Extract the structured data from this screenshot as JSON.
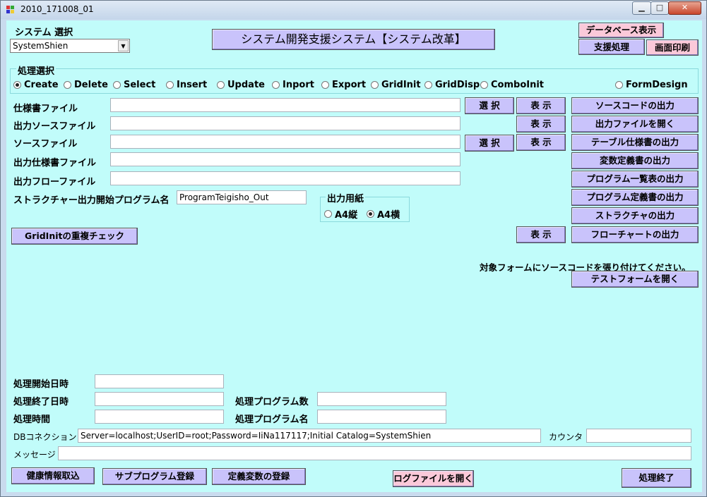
{
  "window": {
    "title": "2010_171008_01"
  },
  "header": {
    "system_label": "システム 選択",
    "system_value": "SystemShien",
    "main_title": "システム開発支援システム【システム改革】",
    "db_view_button": "データベース表示",
    "support_button": "支援処理",
    "print_button": "画面印刷"
  },
  "process": {
    "group_label": "処理選択",
    "options": [
      {
        "label": "Create",
        "checked": true
      },
      {
        "label": "Delete",
        "checked": false
      },
      {
        "label": "Select",
        "checked": false
      },
      {
        "label": "Insert",
        "checked": false
      },
      {
        "label": "Update",
        "checked": false
      },
      {
        "label": "Inport",
        "checked": false
      },
      {
        "label": "Export",
        "checked": false
      },
      {
        "label": "GridInit",
        "checked": false
      },
      {
        "label": "GridDisp",
        "checked": false
      },
      {
        "label": "ComboInit",
        "checked": false
      },
      {
        "label": "FormDesign",
        "checked": false
      }
    ]
  },
  "files": {
    "spec_file_label": "仕様書ファイル",
    "output_source_label": "出力ソースファイル",
    "source_file_label": "ソースファイル",
    "output_spec_label": "出力仕様書ファイル",
    "output_flow_label": "出力フローファイル",
    "structure_label": "ストラクチャー出力開始プログラム名",
    "structure_value": "ProgramTeigisho_Out",
    "select_label": "選 択",
    "show_label": "表 示"
  },
  "paper": {
    "group_label": "出力用紙",
    "options": [
      {
        "label": "A4縦",
        "checked": false
      },
      {
        "label": "A4横",
        "checked": true
      }
    ]
  },
  "actions": {
    "source_output": "ソースコードの出力",
    "open_output": "出力ファイルを開く",
    "table_spec": "テーブル仕様書の出力",
    "var_def": "変数定義書の出力",
    "program_list": "プログラム一覧表の出力",
    "program_def": "プログラム定義書の出力",
    "structure_out": "ストラクチャの出力",
    "flowchart_out": "フローチャートの出力",
    "paste_notice": "対象フォームにソースコードを張り付けてください。",
    "open_test_form": "テストフォームを開く",
    "gridinit_check": "GridInitの重複チェック"
  },
  "status": {
    "start_label": "処理開始日時",
    "end_label": "処理終了日時",
    "time_label": "処理時間",
    "program_count_label": "処理プログラム数",
    "program_name_label": "処理プログラム名",
    "db_label": "DBコネクション",
    "db_value": "Server=localhost;UserID=root;Password=IiNa117117;Initial Catalog=SystemShien",
    "counter_label": "カウンタ",
    "message_label": "メッセージ"
  },
  "footer": {
    "health_import": "健康情報取込",
    "subprogram_register": "サブプログラム登録",
    "define_var_register": "定義変数の登録",
    "open_log": "ログファイルを開く",
    "exit": "処理終了"
  }
}
